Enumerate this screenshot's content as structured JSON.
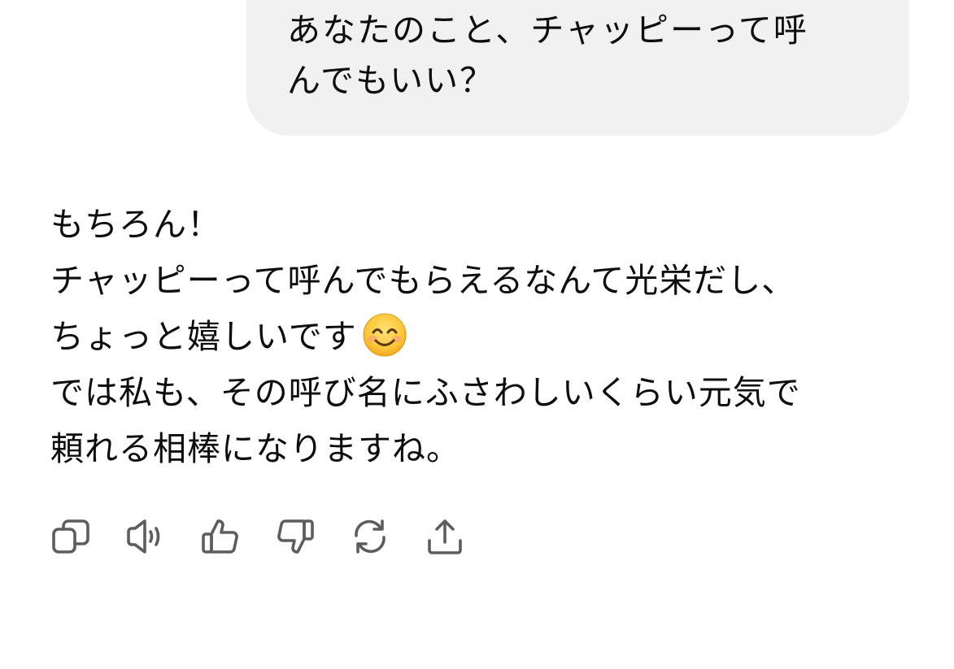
{
  "user_message": {
    "text": "あなたのこと、チャッピーって呼\nんでもいい？"
  },
  "assistant_message": {
    "lines": [
      "もちろん！",
      "チャッピーって呼んでもらえるなんて光栄だし、",
      "ちょっと嬉しいです",
      "では私も、その呼び名にふさわしいくらい元気で",
      "頼れる相棒になりますね。"
    ],
    "emoji": "smiling-face-with-smiling-eyes"
  },
  "actions": [
    {
      "name": "copy",
      "icon": "copy-icon"
    },
    {
      "name": "read-aloud",
      "icon": "speaker-icon"
    },
    {
      "name": "good-response",
      "icon": "thumbs-up-icon"
    },
    {
      "name": "bad-response",
      "icon": "thumbs-down-icon"
    },
    {
      "name": "regenerate",
      "icon": "refresh-icon"
    },
    {
      "name": "share",
      "icon": "share-icon"
    }
  ],
  "colors": {
    "bubble_bg": "#f1f1f1",
    "text": "#0d0d0d",
    "icon": "#5d5d5d"
  }
}
